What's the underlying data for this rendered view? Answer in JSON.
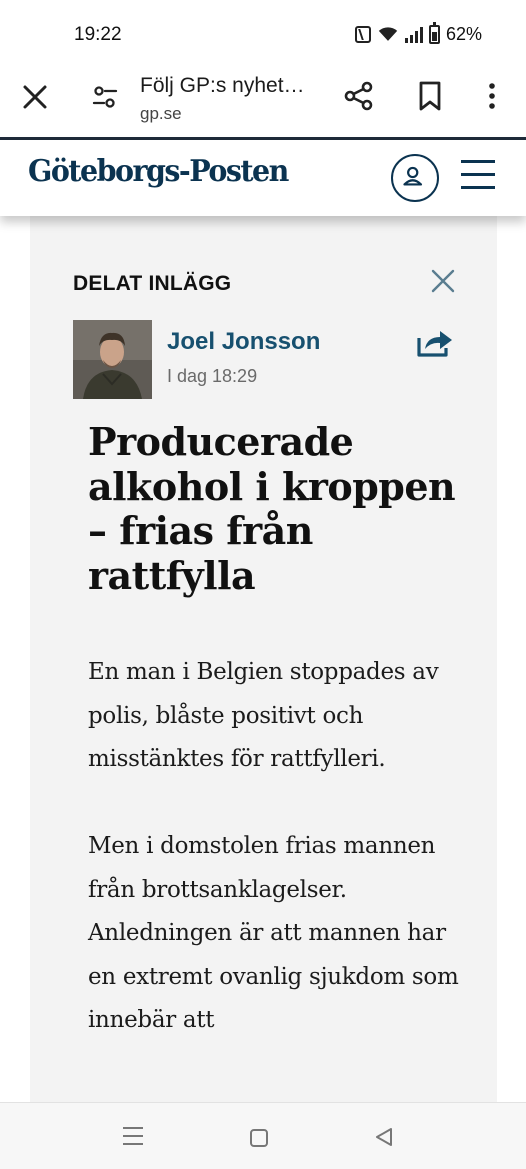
{
  "status_bar": {
    "time": "19:22",
    "battery": "62%",
    "icons": [
      "nfc-icon",
      "wifi-icon",
      "signal-icon",
      "battery-icon"
    ]
  },
  "browser": {
    "page_title": "Följ GP:s nyhet…",
    "domain": "gp.se",
    "icons": [
      "close-icon",
      "tune-icon",
      "share-icon",
      "bookmark-icon",
      "more-vert-icon"
    ]
  },
  "site": {
    "logo_text": "Göteborgs-Posten",
    "brand_color": "#0b3350",
    "icons": [
      "account-icon",
      "menu-icon"
    ]
  },
  "post": {
    "label": "DELAT INLÄGG",
    "author": "Joel Jonsson",
    "time": "I dag 18:29",
    "headline": "Producerade alkohol i kroppen – frias från rattfylla",
    "paragraphs": [
      "En man i Belgien stoppades av polis, blåste positivt och misstänktes för rattfylleri.",
      "Men i domstolen frias mannen från brottsanklagelser. Anledningen är att mannen har en extremt ovanlig sjukdom som innebär att"
    ],
    "author_color": "#17506f",
    "icons": [
      "close-icon",
      "share-arrow-icon"
    ]
  },
  "nav": {
    "icons": [
      "recents-icon",
      "home-icon",
      "back-icon"
    ]
  }
}
